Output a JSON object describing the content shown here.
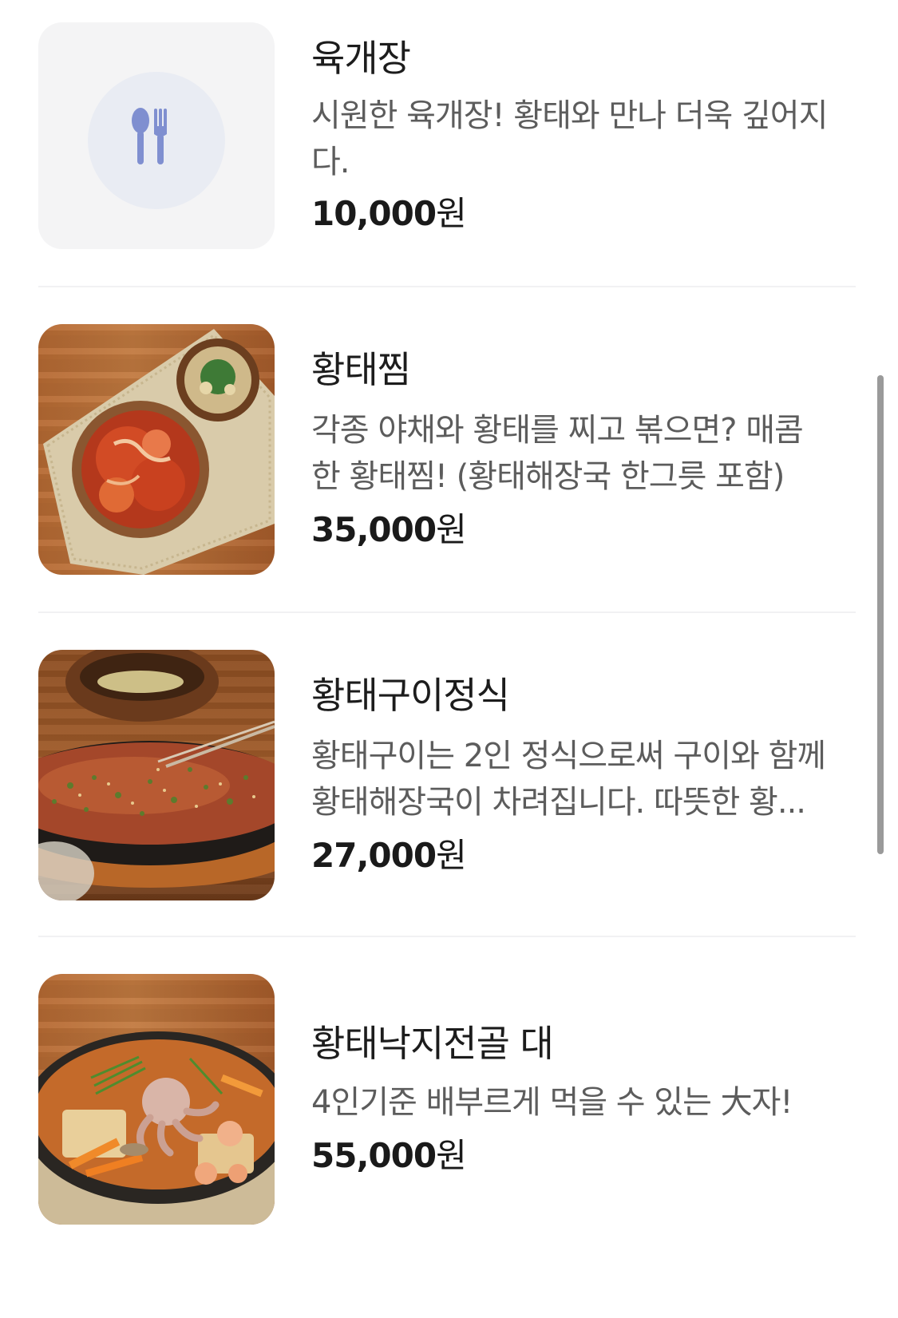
{
  "menu": [
    {
      "name": "육개장",
      "description": "시원한 육개장! 황태와 만나 더욱 깊어지다.",
      "price": "10,000",
      "currency": "원",
      "image": "fork-spoon-placeholder-icon"
    },
    {
      "name": "황태찜",
      "description": "각종 야채와 황태를 찌고 볶으면? 매콤한 황태찜! (황태해장국 한그릇 포함)",
      "price": "35,000",
      "currency": "원",
      "image": "braised-pollack-photo"
    },
    {
      "name": "황태구이정식",
      "description": "황태구이는 2인 정식으로써 구이와 함께 황태해장국이 차려집니다. 따뜻한 황...",
      "price": "27,000",
      "currency": "원",
      "image": "grilled-pollack-photo"
    },
    {
      "name": "황태낙지전골 대",
      "description": "4인기준 배부르게 먹을 수 있는 大자!",
      "price": "55,000",
      "currency": "원",
      "image": "pollack-octopus-hotpot-photo"
    }
  ],
  "colors": {
    "name": "#1c1c1c",
    "description": "#5c5c5c",
    "price": "#1a1a1a",
    "divider": "#f1f1f3",
    "placeholder_bg": "#f4f4f5",
    "placeholder_icon": "#7f8fd0"
  }
}
